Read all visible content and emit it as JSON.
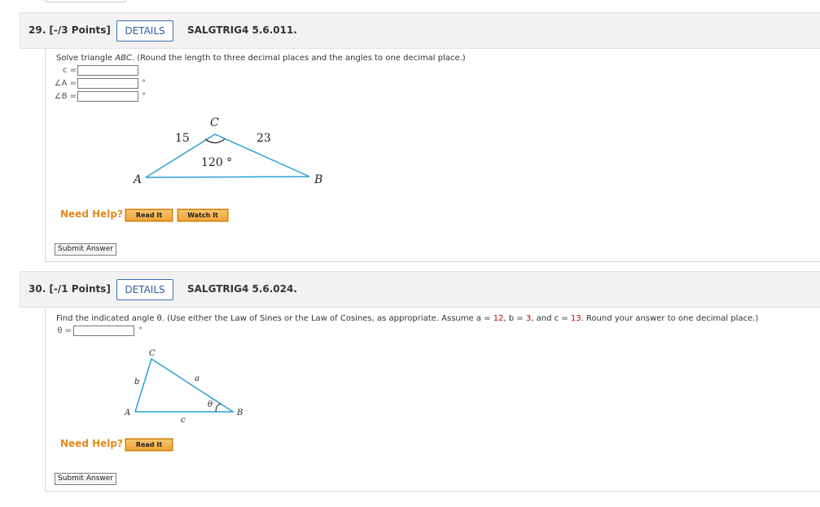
{
  "q29": {
    "number": "29. [-/3 Points]",
    "details": "DETAILS",
    "code": "SALGTRIG4 5.6.011.",
    "prompt_pre": "Solve triangle ",
    "prompt_tri": "ABC",
    "prompt_post": ". (Round the length to three decimal places and the angles to one decimal place.)",
    "fields": [
      {
        "label": "c =",
        "value": "",
        "unit": ""
      },
      {
        "label": "∠A =",
        "value": "",
        "unit": "°"
      },
      {
        "label": "∠B =",
        "value": "",
        "unit": "°"
      }
    ],
    "figure": {
      "side_ac": "15",
      "side_bc": "23",
      "angle_c": "120 °",
      "vertex_a": "A",
      "vertex_b": "B",
      "vertex_c": "C"
    },
    "need_help": "Need Help?",
    "read_it": "Read It",
    "watch_it": "Watch It",
    "submit": "Submit Answer"
  },
  "q30": {
    "number": "30. [-/1 Points]",
    "details": "DETAILS",
    "code": "SALGTRIG4 5.6.024.",
    "prompt_pre": "Find the indicated angle θ. (Use either the Law of Sines or the Law of Cosines, as appropriate. Assume a = ",
    "a_val": "12",
    "prompt_mid1": ", b = ",
    "b_val": "3",
    "prompt_mid2": ", and c = ",
    "c_val": "13",
    "prompt_post": ". Round your answer to one decimal place.)",
    "field": {
      "label": "θ =",
      "value": "",
      "unit": "°"
    },
    "figure": {
      "vertex_a": "A",
      "vertex_b": "B",
      "vertex_c": "C",
      "side_a": "a",
      "side_b": "b",
      "side_c": "c",
      "angle": "θ"
    },
    "need_help": "Need Help?",
    "read_it": "Read It",
    "submit": "Submit Answer"
  },
  "colors": {
    "accent": "#2c5f9e",
    "triangle": "#2a9fd8",
    "help_orange": "#e08a1e",
    "value_red": "#c00000"
  }
}
